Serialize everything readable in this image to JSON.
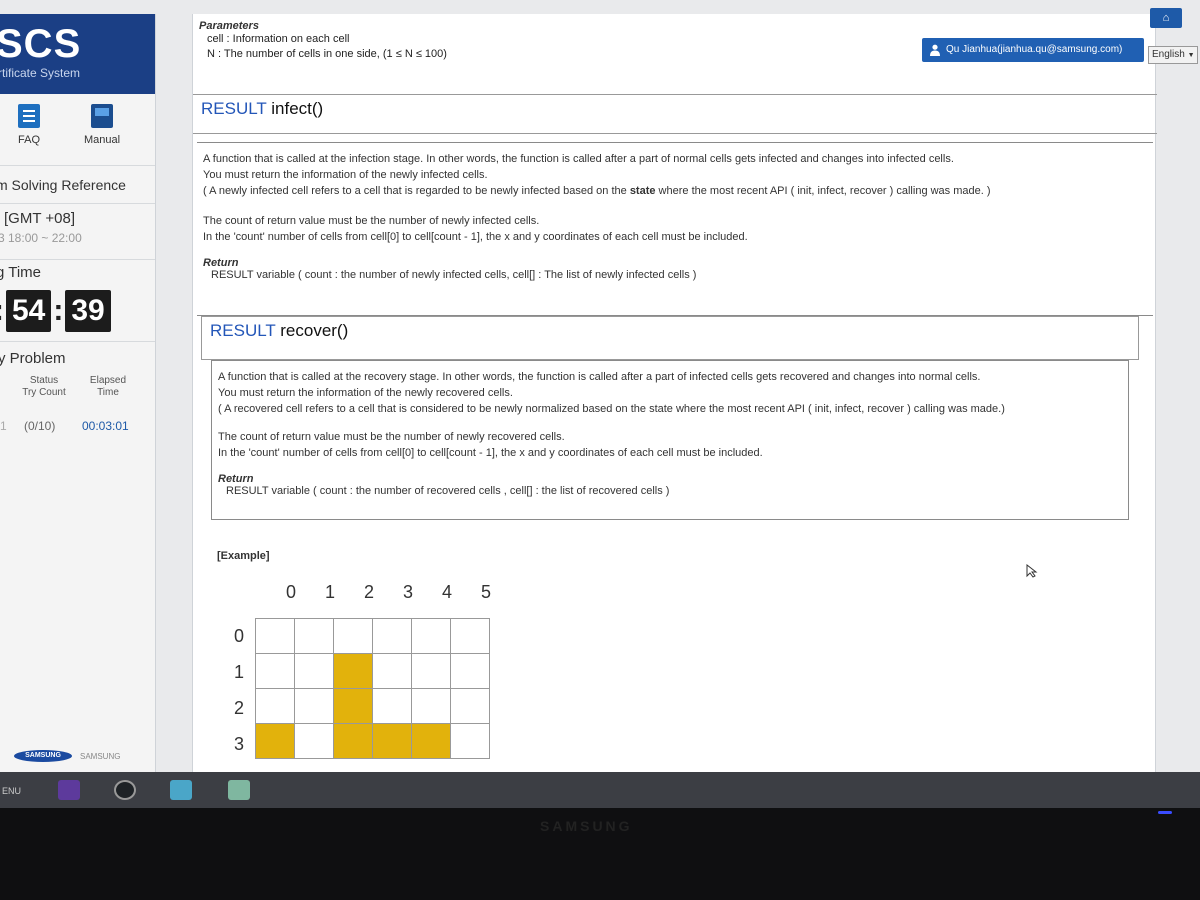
{
  "sidebar": {
    "brand_title": "SCS",
    "brand_subtitle": "rtificate System",
    "faq_label": "FAQ",
    "manual_label": "Manual",
    "reference_label": "m Solving Reference",
    "timezone": "[GMT +08]",
    "hours": "3 18:00 ~ 22:00",
    "timer_label": "g Time",
    "timer_minutes": "54",
    "timer_seconds": "39",
    "problem_label": "y Problem",
    "status_header": "Status\nTry Count",
    "elapsed_header": "Elapsed\nTime",
    "row_prefix": "1",
    "try_count": "(0/10)",
    "elapsed": "00:03:01",
    "samsung_logo": "SAMSUNG",
    "samsung_small": "SAMSUNG"
  },
  "header": {
    "user_label": "Qu Jianhua(jianhua.qu@samsung.com)",
    "language": "English"
  },
  "params": {
    "title": "Parameters",
    "line1": "cell : Information on each cell",
    "line2": "N : The number of cells in one side, (1 ≤ N ≤ 100)"
  },
  "infect": {
    "keyword": "RESULT",
    "name": "infect()",
    "desc1": "A function that is called at the infection stage. In other words, the function is called after a part of normal cells gets infected and changes into infected cells.",
    "desc2": "You must return the information of the newly infected cells.",
    "desc3a": "( A newly infected cell refers to a cell that is regarded to be newly infected based on the ",
    "desc3b": "state",
    "desc3c": " where the most recent API ( init, infect, recover ) calling was made. )",
    "count1": "The count of return value must be the number of newly infected cells.",
    "count2": "In the 'count' number of cells from cell[0] to cell[count - 1], the x and y coordinates of each cell must be included.",
    "return_title": "Return",
    "return_line": "RESULT variable ( count : the number of newly infected cells, cell[] : The list of newly infected cells )"
  },
  "recover": {
    "keyword": "RESULT",
    "name": "recover()",
    "desc1": "A function that is called at the recovery stage. In other words, the function is called after a part of infected cells gets recovered and changes into normal cells.",
    "desc2": "You must return the information of the newly recovered cells.",
    "desc3": "( A recovered cell refers to a cell that is considered to be newly normalized based on the state where the most recent API ( init, infect, recover ) calling was made.)",
    "count1": "The count of return value must be the number of newly recovered cells.",
    "count2": "In the 'count' number of cells from cell[0] to cell[count - 1], the x and y coordinates of each cell must be included.",
    "return_title": "Return",
    "return_line": "RESULT variable ( count : the number of recovered cells , cell[] : the list of recovered cells )"
  },
  "example": {
    "label": "[Example]",
    "columns": [
      "0",
      "1",
      "2",
      "3",
      "4",
      "5"
    ],
    "rows": [
      "0",
      "1",
      "2",
      "3"
    ],
    "infected": [
      [
        1,
        2
      ],
      [
        2,
        2
      ],
      [
        3,
        0
      ],
      [
        3,
        2
      ],
      [
        3,
        3
      ],
      [
        3,
        4
      ]
    ]
  },
  "taskbar": {
    "menu_label": "ENU"
  },
  "monitor": {
    "brand": "SAMSUNG"
  },
  "colors": {
    "accent": "#2356b8",
    "brand_bg": "#1b3f85",
    "infected": "#e2b20c"
  }
}
